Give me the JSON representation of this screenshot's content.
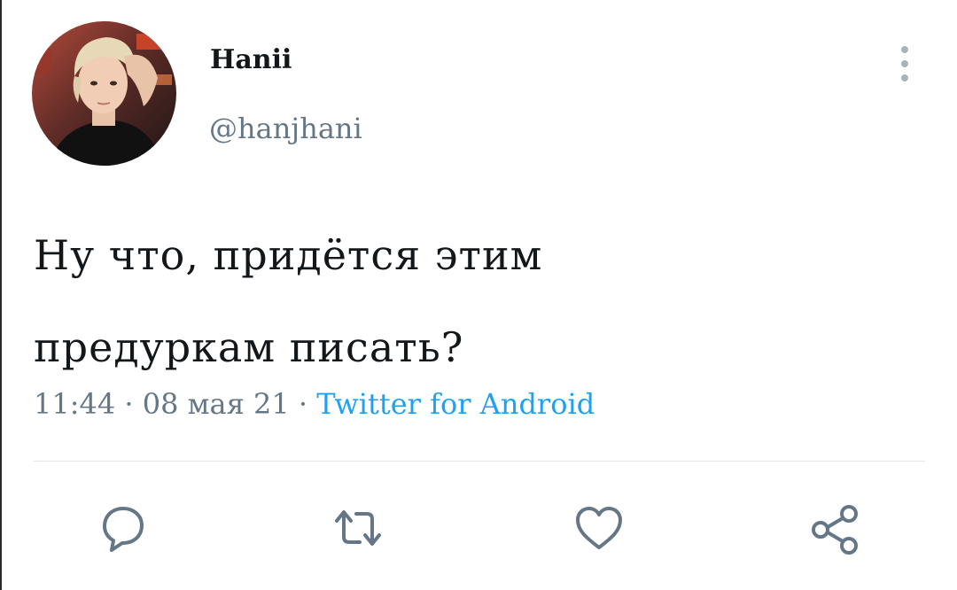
{
  "user": {
    "display_name": "Hanii",
    "handle": "@hanjhani",
    "avatar_icon": "avatar-photo"
  },
  "tweet": {
    "text_lines": [
      "Ну что, придётся этим",
      "предуркам писать?"
    ],
    "time": "11:44",
    "date": "08 мая 21",
    "separator": "·",
    "source": "Twitter for Android"
  },
  "actions": [
    {
      "name": "reply",
      "icon": "comment-icon"
    },
    {
      "name": "retweet",
      "icon": "retweet-icon"
    },
    {
      "name": "like",
      "icon": "heart-icon"
    },
    {
      "name": "share",
      "icon": "share-icon"
    }
  ],
  "colors": {
    "text": "#14171a",
    "secondary": "#657786",
    "link": "#1da1f2",
    "icon": "#657786",
    "divider": "#e1e8ed"
  }
}
